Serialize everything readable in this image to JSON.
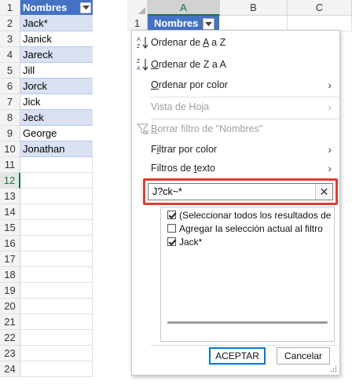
{
  "left_sheet": {
    "rows": [
      {
        "num": "1",
        "value": "Nombres",
        "style": "header"
      },
      {
        "num": "2",
        "value": "Jack*",
        "style": "band"
      },
      {
        "num": "3",
        "value": "Janick",
        "style": "white"
      },
      {
        "num": "4",
        "value": "Jareck",
        "style": "band"
      },
      {
        "num": "5",
        "value": "Jill",
        "style": "white"
      },
      {
        "num": "6",
        "value": "Jorck",
        "style": "band"
      },
      {
        "num": "7",
        "value": "Jick",
        "style": "white"
      },
      {
        "num": "8",
        "value": "Jeck",
        "style": "band"
      },
      {
        "num": "9",
        "value": "George",
        "style": "white"
      },
      {
        "num": "10",
        "value": "Jonathan",
        "style": "band"
      },
      {
        "num": "11",
        "value": "",
        "style": "plain"
      },
      {
        "num": "12",
        "value": "",
        "style": "plain"
      },
      {
        "num": "13",
        "value": "",
        "style": "plain"
      },
      {
        "num": "14",
        "value": "",
        "style": "plain"
      },
      {
        "num": "15",
        "value": "",
        "style": "plain"
      },
      {
        "num": "16",
        "value": "",
        "style": "plain"
      },
      {
        "num": "17",
        "value": "",
        "style": "plain"
      },
      {
        "num": "18",
        "value": "",
        "style": "plain"
      },
      {
        "num": "19",
        "value": "",
        "style": "plain"
      },
      {
        "num": "20",
        "value": "",
        "style": "plain"
      },
      {
        "num": "21",
        "value": "",
        "style": "plain"
      },
      {
        "num": "22",
        "value": "",
        "style": "plain"
      },
      {
        "num": "23",
        "value": "",
        "style": "plain"
      },
      {
        "num": "24",
        "value": "",
        "style": "plain"
      }
    ],
    "active_row": "12"
  },
  "right_sheet": {
    "columns": [
      "A",
      "B",
      "C"
    ],
    "row1_num": "1",
    "header_cell": "Nombres"
  },
  "filter_menu": {
    "sort_az": {
      "pre": "Ordenar de ",
      "accel": "A",
      "post": " a Z"
    },
    "sort_za": {
      "pre": "",
      "accel": "O",
      "post": "rdenar de Z a A"
    },
    "sort_by_color": {
      "pre": "",
      "accel": "O",
      "post": "rdenar por color"
    },
    "sheet_view": "Vista de Hoja",
    "clear_filter": {
      "pre": "",
      "accel": "B",
      "post": "orrar filtro de \"Nombres\""
    },
    "filter_by_color": {
      "pre": "F",
      "accel": "i",
      "post": "ltrar por color"
    },
    "text_filters": {
      "pre": "Filtros de ",
      "accel": "t",
      "post": "exto"
    },
    "search_value": "J?ck~*",
    "search_clear": "✕",
    "list_items": [
      {
        "label": "(Seleccionar todos los resultados de",
        "checked": true,
        "indent": 0
      },
      {
        "label": "Agregar la selección actual al filtro",
        "checked": false,
        "indent": 0
      },
      {
        "label": "Jack*",
        "checked": true,
        "indent": 0
      }
    ],
    "ok_label": "ACEPTAR",
    "cancel_label": "Cancelar"
  },
  "icons": {
    "sort_az": "sort-ascending-icon",
    "sort_za": "sort-descending-icon",
    "clear_filter": "funnel-clear-icon",
    "submenu_arrow": "chevron-right-icon",
    "dropdown": "dropdown-arrow-icon"
  },
  "colors": {
    "table_header": "#4472c4",
    "table_band": "#d9e1f2",
    "excel_green": "#1e7145",
    "highlight_red": "#e03c31",
    "ok_border": "#0078d4"
  }
}
